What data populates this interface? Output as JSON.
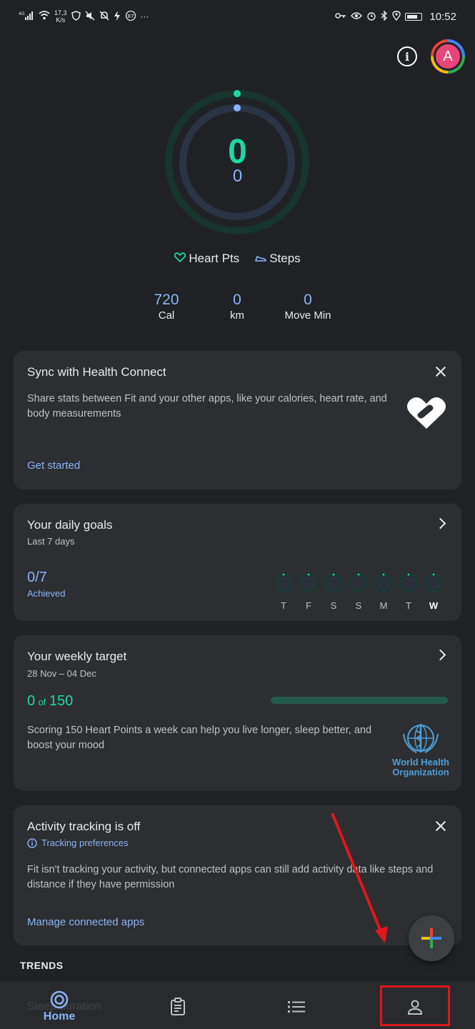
{
  "status_bar": {
    "signal": "4G",
    "net_speed": "17,3",
    "net_unit": "K/s",
    "notification_badge": "87",
    "overflow": "···",
    "time": "10:52"
  },
  "header": {
    "info_icon": "info-icon",
    "avatar_letter": "A"
  },
  "rings": {
    "heart_pts_value": "0",
    "steps_value": "0",
    "outer_color": "#1ed7a4",
    "inner_color": "#8ab4f8"
  },
  "legend": {
    "heart_label": "Heart Pts",
    "steps_label": "Steps"
  },
  "stats": [
    {
      "value": "720",
      "label": "Cal"
    },
    {
      "value": "0",
      "label": "km"
    },
    {
      "value": "0",
      "label": "Move Min"
    }
  ],
  "health_connect_card": {
    "title": "Sync with Health Connect",
    "body": "Share stats between Fit and your other apps, like your calories, heart rate, and body measurements",
    "link": "Get started"
  },
  "daily_goals_card": {
    "title": "Your daily goals",
    "subtitle": "Last 7 days",
    "achieved_value": "0/7",
    "achieved_label": "Achieved",
    "days": [
      "T",
      "F",
      "S",
      "S",
      "M",
      "T",
      "W"
    ]
  },
  "weekly_target_card": {
    "title": "Your weekly target",
    "date_range": "28 Nov – 04 Dec",
    "current": "0",
    "of_label": "of",
    "target": "150",
    "progress_fraction": 0,
    "body": "Scoring 150 Heart Points a week can help you live longer, sleep better, and boost your mood",
    "who_line1": "World Health",
    "who_line2": "Organization"
  },
  "activity_tracking_card": {
    "title": "Activity tracking is off",
    "preferences_link": "Tracking preferences",
    "body": "Fit isn't tracking your activity, but connected apps can still add activity data like steps and distance if they have permission",
    "link": "Manage connected apps"
  },
  "trends_heading": "TRENDS",
  "bottom_nav": {
    "home_label": "Home",
    "ghost_text": "Sleep duration"
  },
  "annotation_color": "#e1161d"
}
